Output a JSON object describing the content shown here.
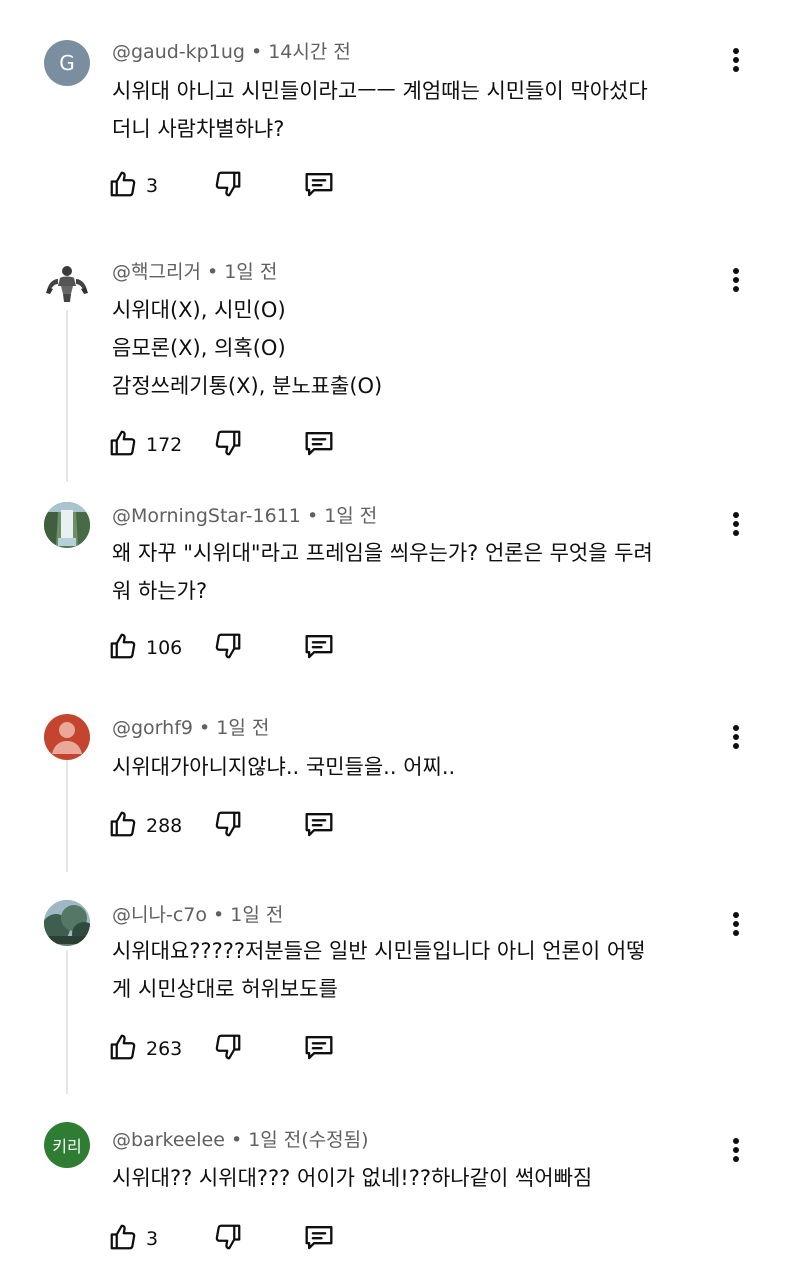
{
  "comments": [
    {
      "author": "@gaud-kp1ug",
      "time": "14시간 전",
      "text": "시위대 아니고 시민들이라고ㅡㅡ 계엄때는 시민들이 막아섰다\n더니 사람차별하냐?",
      "likes": "3",
      "avatar": {
        "type": "letter",
        "letter": "G",
        "color": "#7b8ea0"
      }
    },
    {
      "author": "@핵그리거",
      "time": "1일 전",
      "text": "시위대(X), 시민(O)\n음모론(X), 의혹(O)\n감정쓰레기통(X), 분노표출(O)",
      "likes": "172",
      "avatar": {
        "type": "icon",
        "icon": "muscle-man-icon",
        "color": "#ffffff"
      }
    },
    {
      "author": "@MorningStar-1611",
      "time": "1일 전",
      "text": "왜 자꾸 \"시위대\"라고 프레임을 씌우는가? 언론은 무엇을 두려\n워 하는가?",
      "likes": "106",
      "avatar": {
        "type": "icon",
        "icon": "waterfall-photo-icon",
        "color": "#4f7a55"
      }
    },
    {
      "author": "@gorhf9",
      "time": "1일 전",
      "text": "시위대가아니지않냐.. 국민들을.. 어찌..",
      "likes": "288",
      "avatar": {
        "type": "icon",
        "icon": "default-user-icon",
        "color": "#c4452f"
      }
    },
    {
      "author": "@니나-c7o",
      "time": "1일 전",
      "text": "시위대요?????저분들은 일반 시민들입니다 아니 언론이 어떻\n게 시민상대로 허위보도를",
      "likes": "263",
      "avatar": {
        "type": "icon",
        "icon": "forest-photo-icon",
        "color": "#5b7f74"
      }
    },
    {
      "author": "@barkeelee",
      "time": "1일 전(수정됨)",
      "text": "시위대?? 시위대??? 어이가 없네!??하나같이 썩어빠짐",
      "likes": "3",
      "avatar": {
        "type": "letter",
        "letter": "키리",
        "color": "#2e7d32"
      }
    }
  ]
}
